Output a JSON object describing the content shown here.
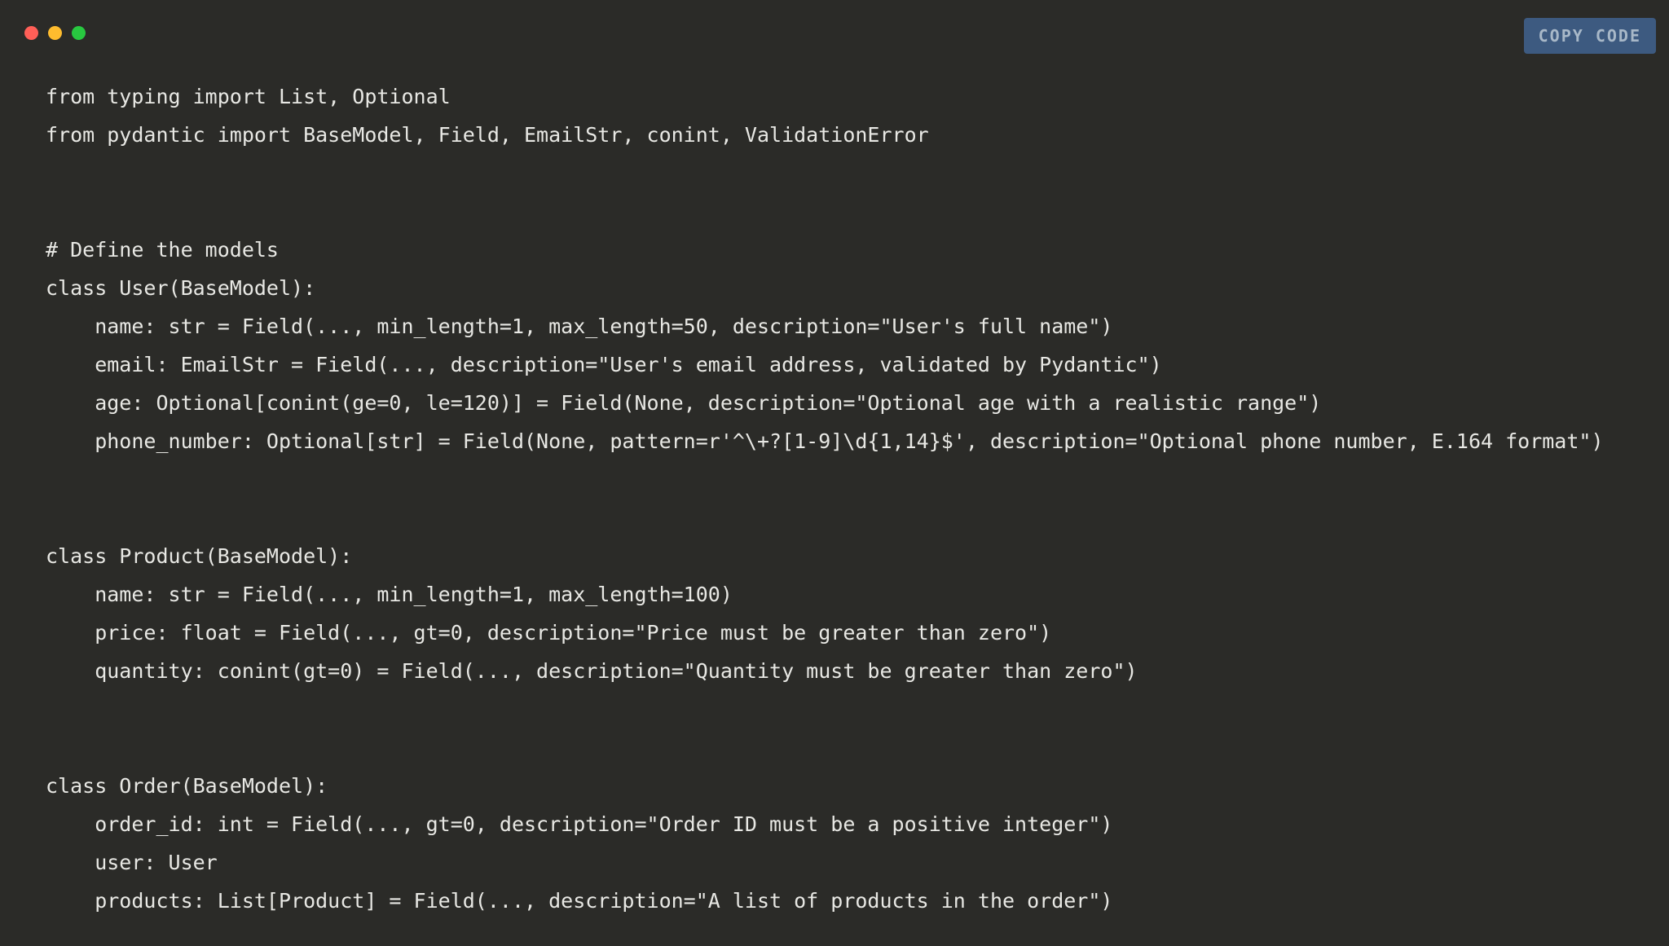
{
  "copy_button_label": "COPY CODE",
  "code": {
    "line1": "from typing import List, Optional",
    "line2": "from pydantic import BaseModel, Field, EmailStr, conint, ValidationError",
    "line3": "",
    "line4": "",
    "line5": "# Define the models",
    "line6": "class User(BaseModel):",
    "line7": "    name: str = Field(..., min_length=1, max_length=50, description=\"User's full name\")",
    "line8": "    email: EmailStr = Field(..., description=\"User's email address, validated by Pydantic\")",
    "line9": "    age: Optional[conint(ge=0, le=120)] = Field(None, description=\"Optional age with a realistic range\")",
    "line10": "    phone_number: Optional[str] = Field(None, pattern=r'^\\+?[1-9]\\d{1,14}$', description=\"Optional phone number, E.164 format\")",
    "line11": "",
    "line12": "",
    "line13": "class Product(BaseModel):",
    "line14": "    name: str = Field(..., min_length=1, max_length=100)",
    "line15": "    price: float = Field(..., gt=0, description=\"Price must be greater than zero\")",
    "line16": "    quantity: conint(gt=0) = Field(..., description=\"Quantity must be greater than zero\")",
    "line17": "",
    "line18": "",
    "line19": "class Order(BaseModel):",
    "line20": "    order_id: int = Field(..., gt=0, description=\"Order ID must be a positive integer\")",
    "line21": "    user: User",
    "line22": "    products: List[Product] = Field(..., description=\"A list of products in the order\")"
  }
}
